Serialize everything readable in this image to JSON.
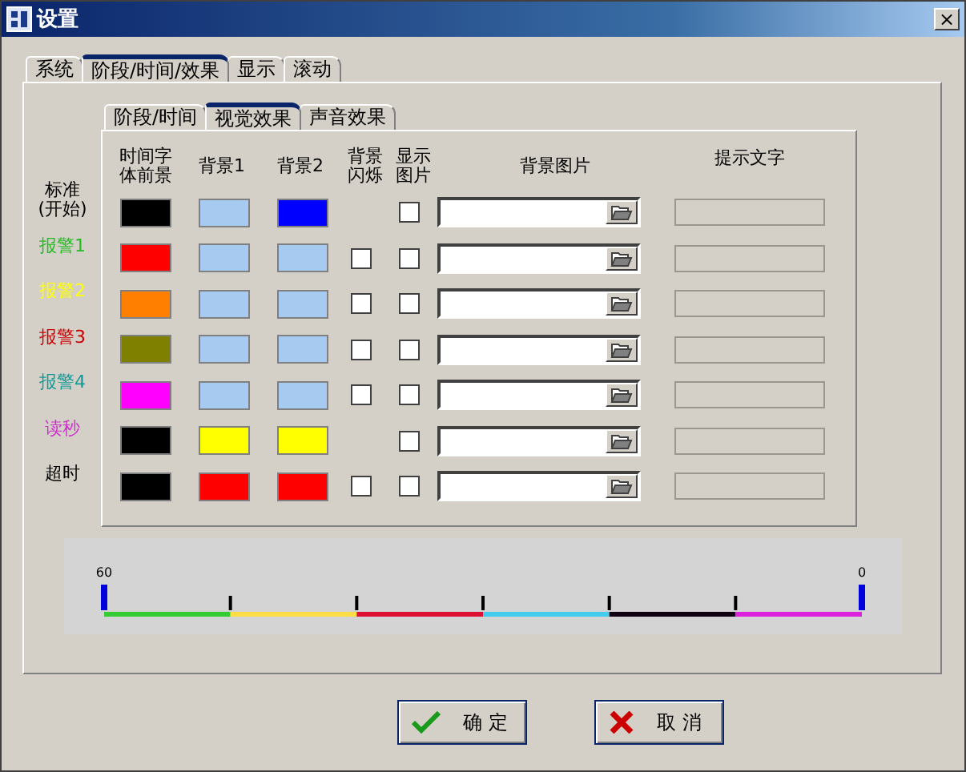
{
  "window": {
    "title": "设置",
    "close_label": "×"
  },
  "tabs": [
    {
      "label": "系统",
      "selected": false
    },
    {
      "label": "阶段/时间/效果",
      "selected": true
    },
    {
      "label": "显示",
      "selected": false
    },
    {
      "label": "滚动",
      "selected": false
    }
  ],
  "subtabs": [
    {
      "label": "阶段/时间",
      "selected": false
    },
    {
      "label": "视觉效果",
      "selected": true
    },
    {
      "label": "声音效果",
      "selected": false
    }
  ],
  "columns": {
    "foreground": "时间字体前景",
    "background_1": "背景1",
    "background_2": "背景2",
    "flash": "背景闪烁",
    "show_picture": "显示图片",
    "picture": "背景图片",
    "hint": "提示文字"
  },
  "rows": [
    {
      "label": "标准\n(开始)",
      "color": "#000000",
      "swatches": [
        {
          "color": "#000000"
        },
        {
          "color": "#a6caf0"
        },
        {
          "color": "#0000ff"
        }
      ],
      "show_picture": false,
      "hint_disabled": true
    },
    {
      "label": "报警1",
      "color": "#22bb22",
      "swatches": [
        {
          "color": "#ff0000"
        },
        {
          "color": "#a6caf0"
        },
        {
          "color": "#a6caf0"
        }
      ],
      "flash": {
        "checked": false
      },
      "show_picture": false,
      "hint_disabled": true
    },
    {
      "label": "报警2",
      "color": "#ffff00",
      "swatches": [
        {
          "color": "#ff8000"
        },
        {
          "color": "#a6caf0"
        },
        {
          "color": "#a6caf0"
        }
      ],
      "flash": {
        "checked": false
      },
      "show_picture": false,
      "hint_disabled": true
    },
    {
      "label": "报警3",
      "color": "#cc0000",
      "swatches": [
        {
          "color": "#808000"
        },
        {
          "color": "#a6caf0"
        },
        {
          "color": "#a6caf0"
        }
      ],
      "flash": {
        "checked": false
      },
      "show_picture": false,
      "hint_disabled": true
    },
    {
      "label": "报警4",
      "color": "#119999",
      "swatches": [
        {
          "color": "#ff00ff"
        },
        {
          "color": "#a6caf0"
        },
        {
          "color": "#a6caf0"
        }
      ],
      "flash": {
        "checked": false
      },
      "show_picture": false,
      "hint_disabled": true
    },
    {
      "label": "读秒",
      "color": "#cc33cc",
      "swatches": [
        {
          "color": "#000000"
        },
        {
          "color": "#ffff00"
        },
        {
          "color": "#ffff00"
        }
      ],
      "show_picture": false,
      "hint_disabled": true
    },
    {
      "label": "超时",
      "color": "#000000",
      "swatches": [
        {
          "color": "#000000"
        },
        {
          "color": "#ff0000"
        },
        {
          "color": "#ff0000"
        }
      ],
      "flash": {
        "checked": false
      },
      "show_picture": false,
      "hint_disabled": true
    }
  ],
  "timeline": {
    "start_label": "60",
    "end_label": "0",
    "segments": [
      {
        "color": "#33cc33"
      },
      {
        "color": "#ffdd44"
      },
      {
        "color": "#dd1133"
      },
      {
        "color": "#44ccee"
      },
      {
        "color": "#110011"
      },
      {
        "color": "#dd22dd"
      }
    ]
  },
  "buttons": [
    {
      "kind": "ok",
      "label": "确 定"
    },
    {
      "kind": "cancel",
      "label": "取 消"
    }
  ]
}
